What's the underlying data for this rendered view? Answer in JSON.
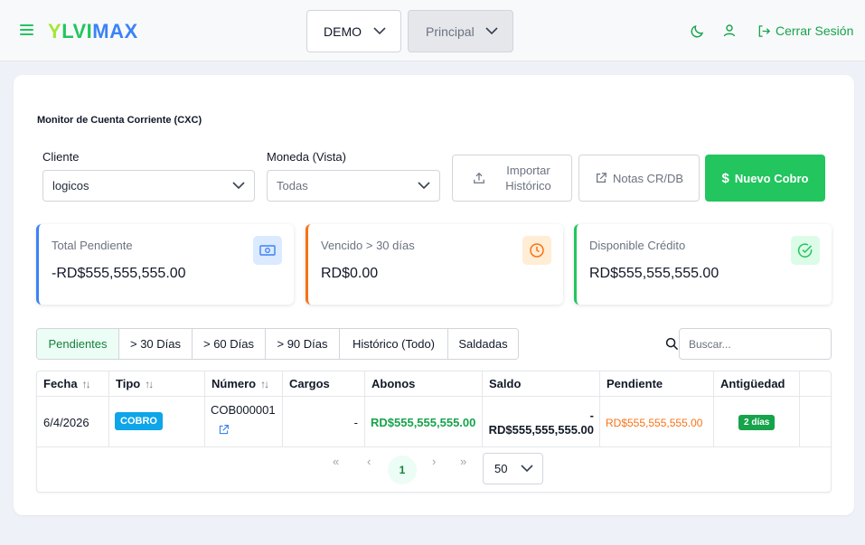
{
  "header": {
    "logo": {
      "part1": "Y",
      "part2": "LVI",
      "part3": "MAX"
    },
    "company_select": "DEMO",
    "branch_select": "Principal",
    "logout_label": "Cerrar Sesión"
  },
  "page": {
    "title": "Monitor de Cuenta Corriente (CXC)",
    "filters": {
      "client_label": "Cliente",
      "client_value": "logicos",
      "currency_label": "Moneda (Vista)",
      "currency_value": "Todas"
    },
    "actions": {
      "import_line1": "Importar",
      "import_line2": "Histórico",
      "notes_label": "Notas CR/DB",
      "new_label": "Nuevo Cobro"
    }
  },
  "stats": [
    {
      "label": "Total Pendiente",
      "value": "-RD$555,555,555.00",
      "accent": "#3b82f6"
    },
    {
      "label": "Vencido > 30 días",
      "value": "RD$0.00",
      "accent": "#f97316"
    },
    {
      "label": "Disponible Crédito",
      "value": "RD$555,555,555.00",
      "accent": "#22c55e"
    }
  ],
  "tabs": [
    "Pendientes",
    "> 30 Días",
    "> 60 Días",
    "> 90 Días",
    "Histórico (Todo)",
    "Saldadas"
  ],
  "search": {
    "placeholder": "Buscar..."
  },
  "table": {
    "columns": [
      "Fecha",
      "Tipo",
      "Número",
      "Cargos",
      "Abonos",
      "Saldo",
      "Pendiente",
      "Antigüedad"
    ],
    "rows": [
      {
        "fecha": "6/4/2026",
        "tipo": "COBRO",
        "numero": "COB000001",
        "cargos": "-",
        "abonos": "RD$555,555,555.00",
        "saldo_sign": "-",
        "saldo": "RD$555,555,555.00",
        "pendiente": "RD$555,555,555.00",
        "antiguedad": "2 días"
      }
    ]
  },
  "pagination": {
    "current_page": "1",
    "per_page": "50"
  },
  "colors": {
    "brand": "#22c55e",
    "info": "#0ea5e9",
    "warning": "#f97316"
  }
}
